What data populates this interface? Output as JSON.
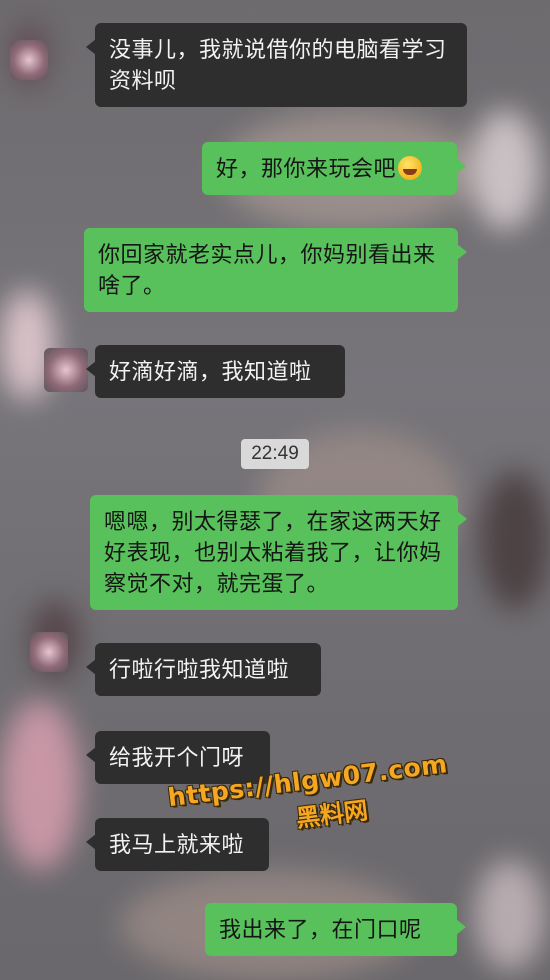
{
  "messages": [
    {
      "side": "in",
      "text": "没事儿，我就说借你的电脑看学习资料呗"
    },
    {
      "side": "out",
      "text": "好，那你来玩会吧",
      "emoji": "laughing-tears-emoji"
    },
    {
      "side": "out",
      "text": "你回家就老实点儿，你妈别看出来啥了。"
    },
    {
      "side": "in",
      "text": "好滴好滴，我知道啦"
    },
    {
      "side": "out",
      "text": "嗯嗯，别太得瑟了，在家这两天好好表现，也别太粘着我了，让你妈察觉不对，就完蛋了。"
    },
    {
      "side": "in",
      "text": "行啦行啦我知道啦"
    },
    {
      "side": "in",
      "text": "给我开个门呀"
    },
    {
      "side": "in",
      "text": "我马上就来啦"
    },
    {
      "side": "out",
      "text": "我出来了，在门口呢"
    }
  ],
  "timestamp": "22:49",
  "watermark": {
    "url": "https://hlgw07.com",
    "site": "黑料网"
  },
  "colors": {
    "incoming_bubble": "#2e2e2e",
    "outgoing_bubble": "#58c15b",
    "timestamp_bg": "#d9d9d9",
    "watermark": "#f5a623"
  }
}
